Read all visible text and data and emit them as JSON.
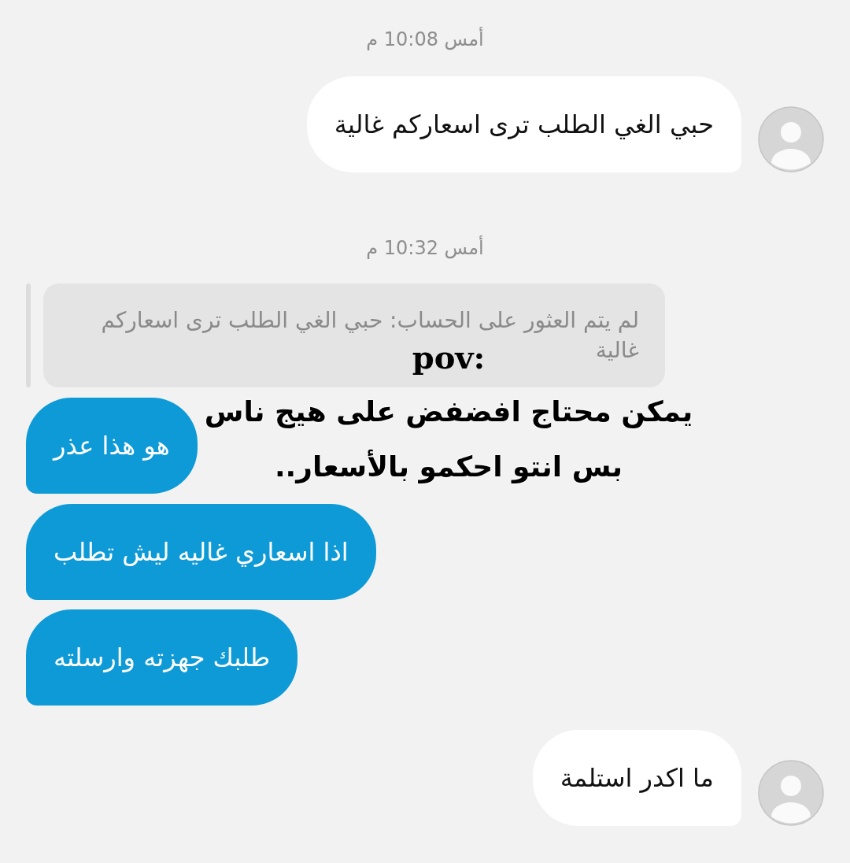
{
  "messages": [
    {
      "kind": "timestamp",
      "text": "أمس 10:08 م"
    },
    {
      "kind": "sent",
      "text": "حبي الغي الطلب ترى اسعاركم غالية",
      "avatar": true
    },
    {
      "kind": "timestamp",
      "text": "أمس 10:32 م"
    },
    {
      "kind": "reply",
      "text": "لم يتم العثور على الحساب: حبي الغي الطلب ترى اسعاركم غالية"
    },
    {
      "kind": "received",
      "text": "هو هذا عذر"
    },
    {
      "kind": "received",
      "text": "اذا اسعاري غاليه ليش تطلب"
    },
    {
      "kind": "received",
      "text": "طلبك جهزته وارسلته"
    },
    {
      "kind": "sent",
      "text": "ما اكدر استلمة",
      "avatar": true
    }
  ],
  "caption": {
    "title": "pov:",
    "lines": [
      "يمكن محتاج افضفض على هيج ناس",
      "بس انتو احكمو بالأسعار.."
    ]
  }
}
